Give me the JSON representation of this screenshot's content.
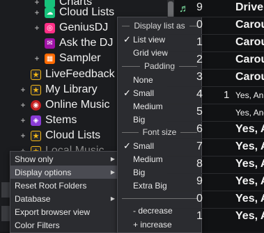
{
  "tree": {
    "items": [
      {
        "label": "Charts",
        "icon": "folder-icon"
      },
      {
        "label": "Cloud Lists",
        "icon": "cloud-folder-icon"
      },
      {
        "label": "GeniusDJ",
        "icon": "genius-icon"
      },
      {
        "label": "Ask the DJ",
        "icon": "ask-dj-icon"
      },
      {
        "label": "Sampler",
        "icon": "sampler-icon"
      },
      {
        "label": "LiveFeedback",
        "icon": "star-folder-icon"
      },
      {
        "label": "My Library",
        "icon": "star-folder-icon"
      },
      {
        "label": "Online Music",
        "icon": "online-music-icon"
      },
      {
        "label": "Stems",
        "icon": "stems-icon"
      },
      {
        "label": "Cloud Lists",
        "icon": "star-folder-icon"
      },
      {
        "label": "Local Music",
        "icon": "star-folder-icon"
      }
    ]
  },
  "list": {
    "rows": [
      {
        "num": "9",
        "track": "",
        "title": "Drive"
      },
      {
        "num": "0",
        "track": "",
        "title": "Carou"
      },
      {
        "num": "1",
        "track": "",
        "title": "Carou"
      },
      {
        "num": "2",
        "track": "",
        "title": "Carou"
      },
      {
        "num": "3",
        "track": "",
        "title": "Carou"
      },
      {
        "num": "4",
        "track": "1",
        "title": "Yes, An"
      },
      {
        "num": "5",
        "track": "",
        "title": "Yes, And"
      },
      {
        "num": "6",
        "track": "",
        "title": "Yes, A"
      },
      {
        "num": "7",
        "track": "",
        "title": "Yes, A"
      },
      {
        "num": "8",
        "track": "",
        "title": "Yes, A"
      },
      {
        "num": "9",
        "track": "",
        "title": "Yes, A"
      },
      {
        "num": "0",
        "track": "",
        "title": "Yes, A"
      },
      {
        "num": "1",
        "track": "",
        "title": "Yes, A"
      }
    ]
  },
  "context_menu": {
    "items": [
      {
        "label": "Show only",
        "submenu": true
      },
      {
        "label": "Display options",
        "submenu": true,
        "highlighted": true
      },
      {
        "label": "Reset Root Folders",
        "submenu": false
      },
      {
        "label": "Database",
        "submenu": true
      },
      {
        "label": "Export browser view",
        "submenu": false
      },
      {
        "label": "Color Filters",
        "submenu": false
      }
    ]
  },
  "display_menu": {
    "section_display": "Display list as",
    "list_view": "List view",
    "grid_view": "Grid view",
    "section_padding": "Padding",
    "pad_none": "None",
    "pad_small": "Small",
    "pad_medium": "Medium",
    "pad_big": "Big",
    "section_font": "Font size",
    "font_small": "Small",
    "font_medium": "Medium",
    "font_big": "Big",
    "font_extra_big": "Extra Big",
    "decrease": "- decrease",
    "increase": "+ increase",
    "checked_list": "List view",
    "checked_padding": "Small",
    "checked_font": "Small"
  },
  "colors": {
    "accent_green": "#17c27b",
    "highlight": "#4a4b52"
  }
}
